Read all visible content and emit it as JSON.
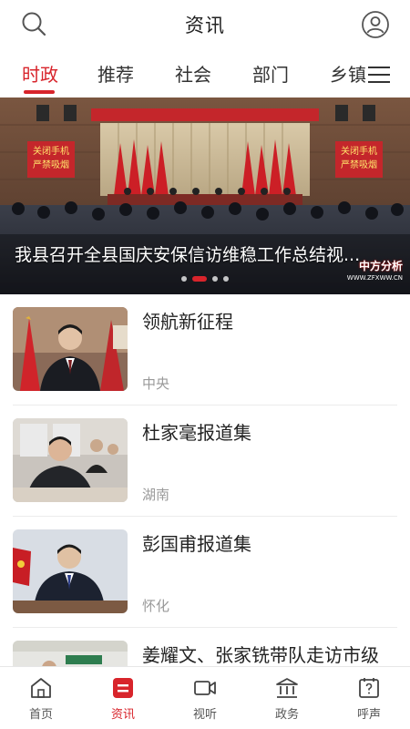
{
  "header": {
    "title": "资讯",
    "search_icon": "search-icon",
    "user_icon": "user-icon"
  },
  "tabs": [
    {
      "label": "时政",
      "active": true
    },
    {
      "label": "推荐",
      "active": false
    },
    {
      "label": "社会",
      "active": false
    },
    {
      "label": "部门",
      "active": false
    },
    {
      "label": "乡镇",
      "active": false
    }
  ],
  "tabs_menu_icon": "menu-icon",
  "banner": {
    "caption": "我县召开全县国庆安保信访维稳工作总结视...",
    "left_sign": [
      "关闭手机",
      "严禁吸烟"
    ],
    "right_sign": [
      "关闭手机",
      "严禁吸烟"
    ],
    "watermark": "中方分析",
    "watermark_url": "WWW.ZFXWW.CN",
    "slide_count": 4,
    "active_slide": 2
  },
  "news": [
    {
      "headline": "领航新征程",
      "source": "中央"
    },
    {
      "headline": "杜家毫报道集",
      "source": "湖南"
    },
    {
      "headline": "彭国甫报道集",
      "source": "怀化"
    },
    {
      "headline": "姜耀文、张家铣带队走访市级",
      "source": ""
    }
  ],
  "bottom_nav": [
    {
      "label": "首页",
      "icon": "home-icon",
      "active": false
    },
    {
      "label": "资讯",
      "icon": "news-icon",
      "active": true
    },
    {
      "label": "视听",
      "icon": "video-icon",
      "active": false
    },
    {
      "label": "政务",
      "icon": "government-icon",
      "active": false
    },
    {
      "label": "呼声",
      "icon": "voice-icon",
      "active": false
    }
  ],
  "colors": {
    "accent": "#d8242b",
    "text": "#222222",
    "muted": "#999999"
  }
}
